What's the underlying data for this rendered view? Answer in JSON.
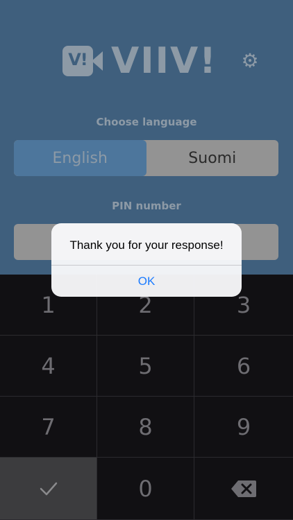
{
  "header": {
    "logo_badge": "V!",
    "logo_text": "VIIV!",
    "settings_icon": "gear-icon"
  },
  "language": {
    "label": "Choose language",
    "options": [
      "English",
      "Suomi"
    ],
    "selected": "English"
  },
  "pin": {
    "label": "PIN number",
    "value": ""
  },
  "keypad": {
    "keys": [
      "1",
      "2",
      "3",
      "4",
      "5",
      "6",
      "7",
      "8",
      "9",
      "",
      "0",
      ""
    ],
    "done_icon": "checkmark-icon",
    "delete_icon": "backspace-icon"
  },
  "alert": {
    "message": "Thank you for your response!",
    "ok_label": "OK"
  },
  "colors": {
    "background": "#3f5f7d",
    "accent": "#1b7bff",
    "keypad": "#111013"
  }
}
